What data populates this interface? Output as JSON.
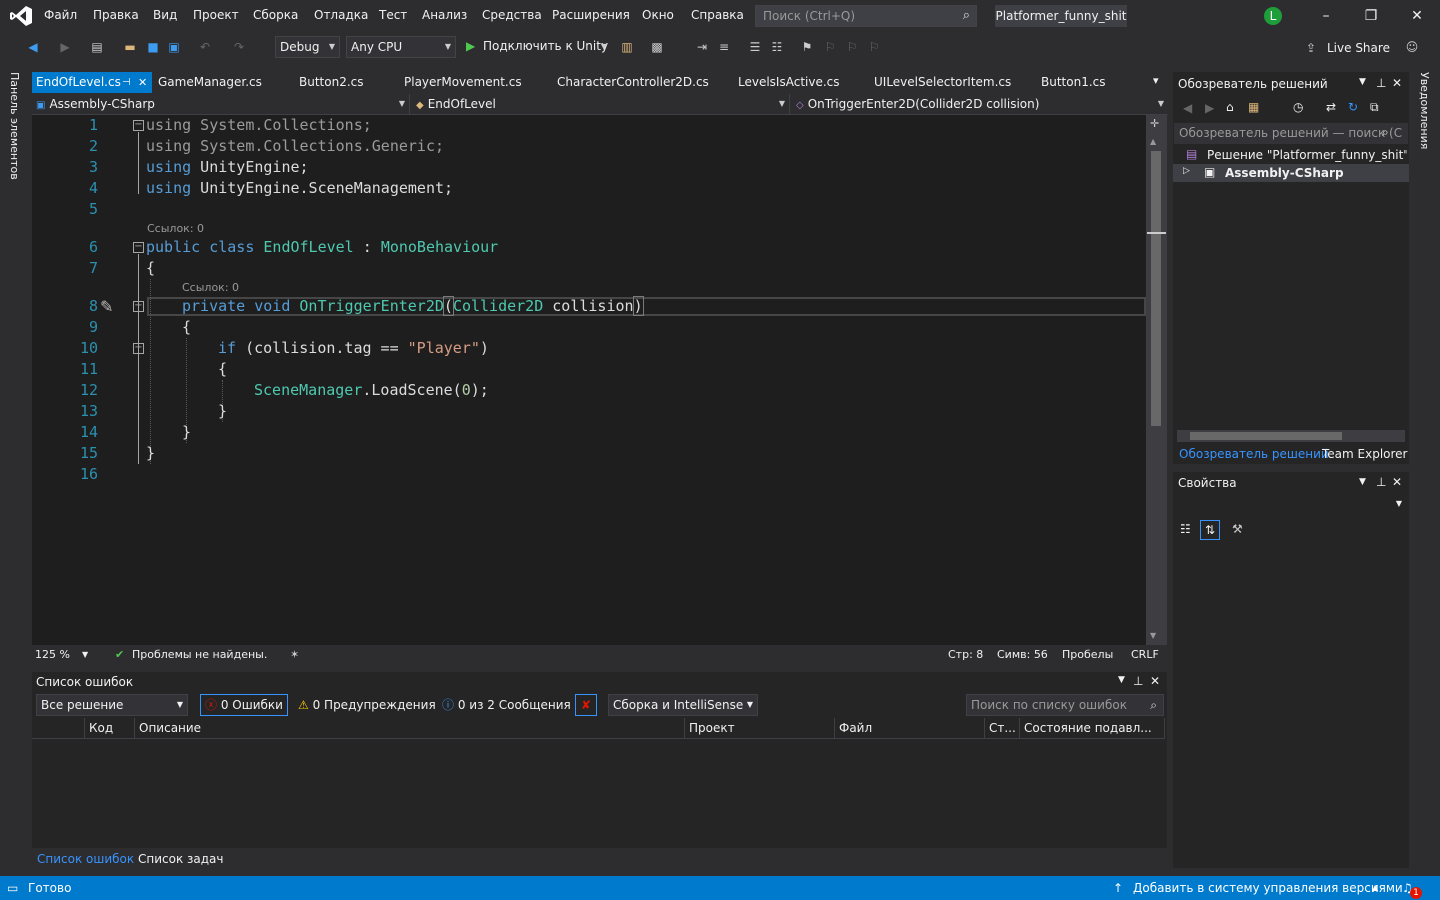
{
  "titlebar": {
    "menus": [
      "Файл",
      "Правка",
      "Вид",
      "Проект",
      "Сборка",
      "Отладка",
      "Тест",
      "Анализ",
      "Средства",
      "Расширения",
      "Окно",
      "Справка"
    ],
    "search_placeholder": "Поиск (Ctrl+Q)",
    "project_name": "Platformer_funny_shit",
    "avatar_letter": "L",
    "brand_color": "#68217a"
  },
  "toolbar": {
    "config": "Debug",
    "platform": "Any CPU",
    "run_label": "Подключить к Unity",
    "live_share": "Live Share"
  },
  "left_strip": {
    "label": "Панель элементов"
  },
  "right_strip": {
    "label": "Уведомления"
  },
  "tabs": [
    {
      "label": "EndOfLevel.cs",
      "active": true
    },
    {
      "label": "GameManager.cs"
    },
    {
      "label": "Button2.cs"
    },
    {
      "label": "PlayerMovement.cs"
    },
    {
      "label": "CharacterController2D.cs"
    },
    {
      "label": "LevelsIsActive.cs"
    },
    {
      "label": "UILevelSelectorItem.cs"
    },
    {
      "label": "Button1.cs"
    }
  ],
  "navbar": {
    "project": "Assembly-CSharp",
    "class": "EndOfLevel",
    "member": "OnTriggerEnter2D(Collider2D collision)"
  },
  "editor": {
    "line_numbers": [
      "1",
      "2",
      "3",
      "4",
      "5",
      "6",
      "7",
      "8",
      "9",
      "10",
      "11",
      "12",
      "13",
      "14",
      "15",
      "16"
    ],
    "code_lens": "Ссылок: 0",
    "code": {
      "l1a": "using",
      "l1b": " System.Collections;",
      "l2a": "using",
      "l2b": " System.Collections.Generic;",
      "l3a": "using",
      "l3b": " UnityEngine;",
      "l4a": "using",
      "l4b": " UnityEngine.SceneManagement;",
      "l6a": "public class ",
      "l6b": "EndOfLevel",
      "l6c": " : ",
      "l6d": "MonoBehaviour",
      "l7": "{",
      "l8a": "private void ",
      "l8b": "OnTriggerEnter2D",
      "l8c": "(",
      "l8d": "Collider2D",
      "l8e": " collision",
      "l8f": ")",
      "l9": "{",
      "l10a": "if",
      "l10b": " (collision.tag == ",
      "l10c": "\"Player\"",
      "l10d": ")",
      "l11": "{",
      "l12a": "SceneManager",
      "l12b": ".LoadScene(",
      "l12c": "0",
      "l12d": ");",
      "l13": "}",
      "l14": "}",
      "l15": "}"
    }
  },
  "editor_status": {
    "zoom": "125 %",
    "issues": "Проблемы не найдены.",
    "line": "Стр: 8",
    "col": "Симв: 56",
    "whitespace": "Пробелы",
    "eol": "CRLF"
  },
  "error_list": {
    "title": "Список ошибок",
    "scope": "Все решение",
    "errors": "0 Ошибки",
    "warnings": "0 Предупреждения",
    "messages": "0 из 2 Сообщения",
    "source": "Сборка и IntelliSense",
    "search_placeholder": "Поиск по списку ошибок",
    "columns": [
      "Код",
      "Описание",
      "Проект",
      "Файл",
      "Ст...",
      "Состояние подавл..."
    ],
    "bottom_tabs": [
      "Список ошибок",
      "Список задач"
    ]
  },
  "solution_explorer": {
    "title": "Обозреватель решений",
    "search_placeholder": "Обозреватель решений — поиск (C",
    "solution_node": "Решение \"Platformer_funny_shit\" (пр",
    "project_node": "Assembly-CSharp",
    "bottom_tabs": [
      "Обозреватель решений",
      "Team Explorer"
    ]
  },
  "properties": {
    "title": "Свойства"
  },
  "statusbar": {
    "ready": "Готово",
    "source_control": "Добавить в систему управления версиями",
    "notifications_count": "1"
  }
}
